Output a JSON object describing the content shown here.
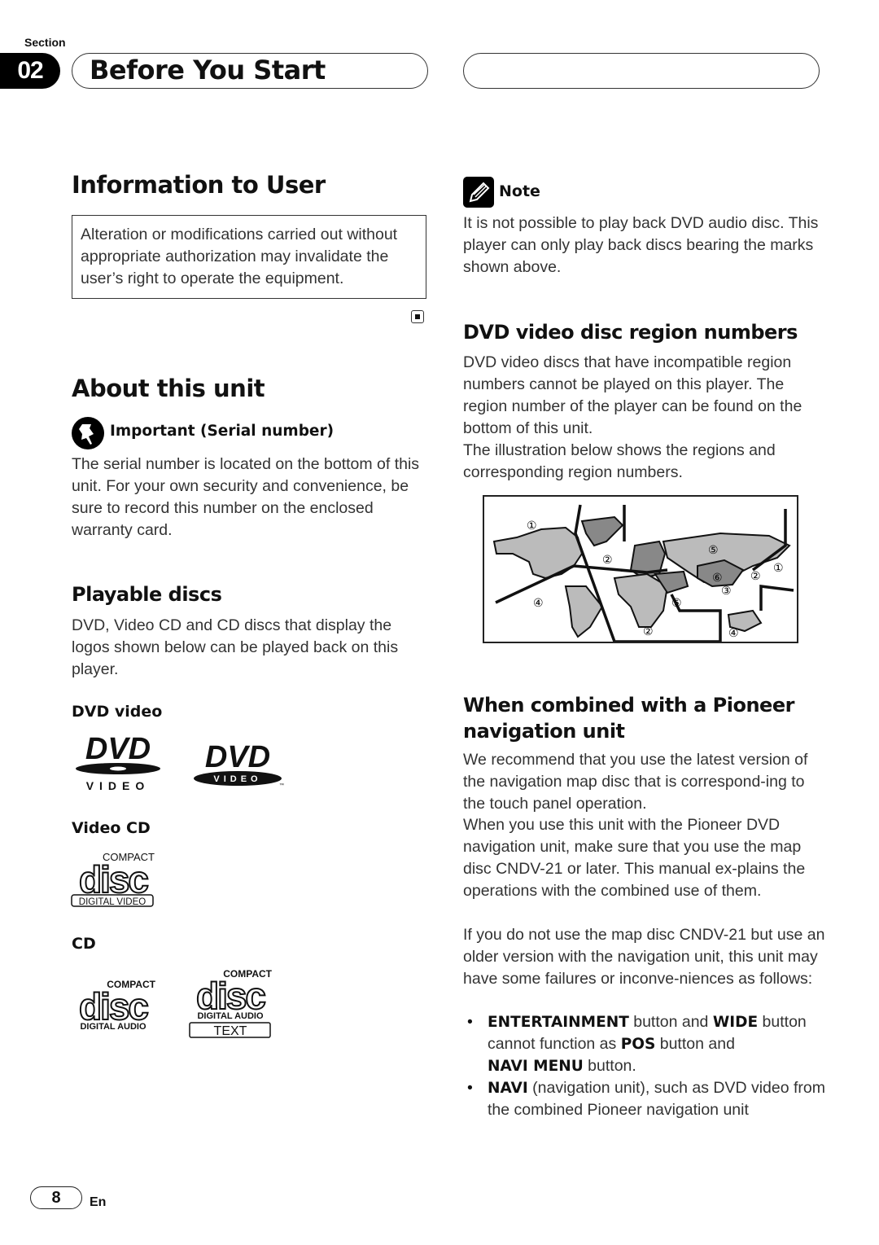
{
  "header": {
    "section_label": "Section",
    "section_number": "02",
    "section_title": "Before You Start"
  },
  "left": {
    "info_heading": "Information to User",
    "notice_text": "Alteration or modifications carried out without appropriate authorization may invalidate the user’s right to operate the equipment.",
    "about_heading": "About this unit",
    "important_label": "Important (Serial number)",
    "important_text": "The serial number is located on the bottom of this unit. For your own security and convenience, be sure to record this number on the enclosed warranty card.",
    "playable_heading": "Playable discs",
    "playable_text": "DVD, Video CD and CD discs that display the logos shown below can be played back on this player.",
    "logos": {
      "dvd_label": "DVD video",
      "dvd_logo_text": "DVD",
      "dvd_logo_sub": "VIDEO",
      "vcd_label": "Video CD",
      "cd_label": "CD",
      "compact": "COMPACT",
      "disc": "disc",
      "digital_video": "DIGITAL VIDEO",
      "digital_audio": "DIGITAL AUDIO",
      "text": "TEXT",
      "tm": "™"
    }
  },
  "right": {
    "note_label": "Note",
    "note_text": "It is not possible to play back DVD audio disc. This player can only play back discs bearing the marks shown above.",
    "region_heading": "DVD video disc region numbers",
    "region_text_1": "DVD video discs that have incompatible region numbers cannot be played on this player. The region number of the player can be found on the bottom of this unit.",
    "region_text_2": "The illustration below shows the regions and corresponding region numbers.",
    "map_labels": [
      "①",
      "②",
      "④",
      "②",
      "⑤",
      "⑤",
      "⑥",
      "③",
      "②",
      "①",
      "④"
    ],
    "combined_heading": "When combined with a Pioneer navigation unit",
    "combined_text_1": "We recommend that you use the latest version of the navigation map disc that is correspond-ing to the touch panel operation.",
    "combined_text_2": "When you use this unit with the Pioneer DVD navigation unit, make sure that you use the map disc CNDV-21 or later. This manual ex-plains the operations with the combined use of them.",
    "combined_text_3": "If you do not use the map disc CNDV-21 but use an older version with the navigation unit, this unit may have some failures or inconve-niences as follows:",
    "bullets": [
      {
        "kw1": "ENTERTAINMENT",
        "t1": " button and ",
        "kw2": "WIDE",
        "t2": " button cannot function as ",
        "kw3": "POS",
        "t3": " button and ",
        "kw4": "NAVI MENU",
        "t4": " button."
      },
      {
        "kw1": "NAVI",
        "t1": " (navigation unit), such as DVD video from the combined Pioneer navigation unit"
      }
    ]
  },
  "footer": {
    "page_number": "8",
    "language": "En"
  }
}
